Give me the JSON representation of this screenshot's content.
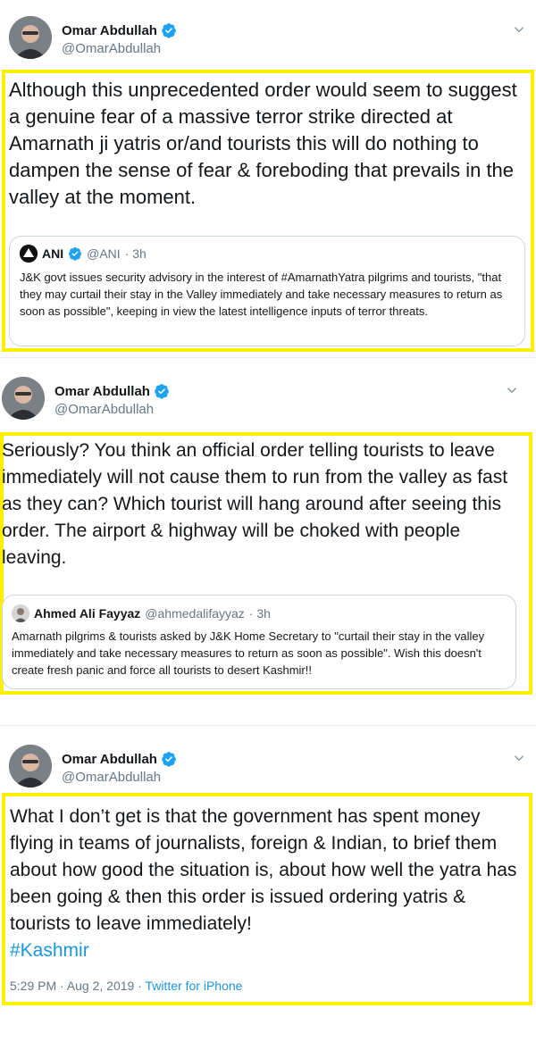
{
  "colors": {
    "highlight": "#ffee00",
    "link": "#1b95e0",
    "verified": "#1da1f2",
    "muted": "#657786"
  },
  "tweets": [
    {
      "author_name": "Omar Abdullah",
      "author_handle": "@OmarAbdullah",
      "text": "Although this unprecedented order would seem to suggest a genuine fear of a massive terror strike directed at Amarnath ji yatris or/and tourists this will do nothing to dampen the sense of fear & foreboding that prevails in the valley at the moment.",
      "quote": {
        "name": "ANI",
        "handle": "@ANI",
        "time": "· 3h",
        "text": "J&K govt issues security advisory in the interest of #AmarnathYatra pilgrims and tourists, \"that they may curtail their stay in the Valley immediately and take necessary measures to return as soon as possible\", keeping in view the latest intelligence inputs of terror threats."
      }
    },
    {
      "author_name": "Omar Abdullah",
      "author_handle": "@OmarAbdullah",
      "text": "Seriously? You think an official order telling tourists to leave immediately will not cause them to run from the valley as fast as they can? Which tourist will hang around after seeing this order. The airport & highway will be choked with people leaving.",
      "quote": {
        "name": "Ahmed Ali Fayyaz",
        "handle": "@ahmedalifayyaz",
        "time": "· 3h",
        "text": "Amarnath pilgrims & tourists asked by J&K Home Secretary to \"curtail their stay in the valley immediately and take necessary measures to return as soon as possible\". Wish this doesn't create fresh panic and force all tourists to desert Kashmir!!"
      }
    },
    {
      "author_name": "Omar Abdullah",
      "author_handle": "@OmarAbdullah",
      "text": "What I don’t get is that the government has spent money flying in teams of journalists, foreign & Indian, to brief them about how good the situation is, about how well the yatra has been going & then this order is issued ordering yatris & tourists to leave immediately!",
      "hashtag": "#Kashmir",
      "timestamp": "5:29 PM · Aug 2, 2019 ·",
      "source": "Twitter for iPhone"
    }
  ]
}
